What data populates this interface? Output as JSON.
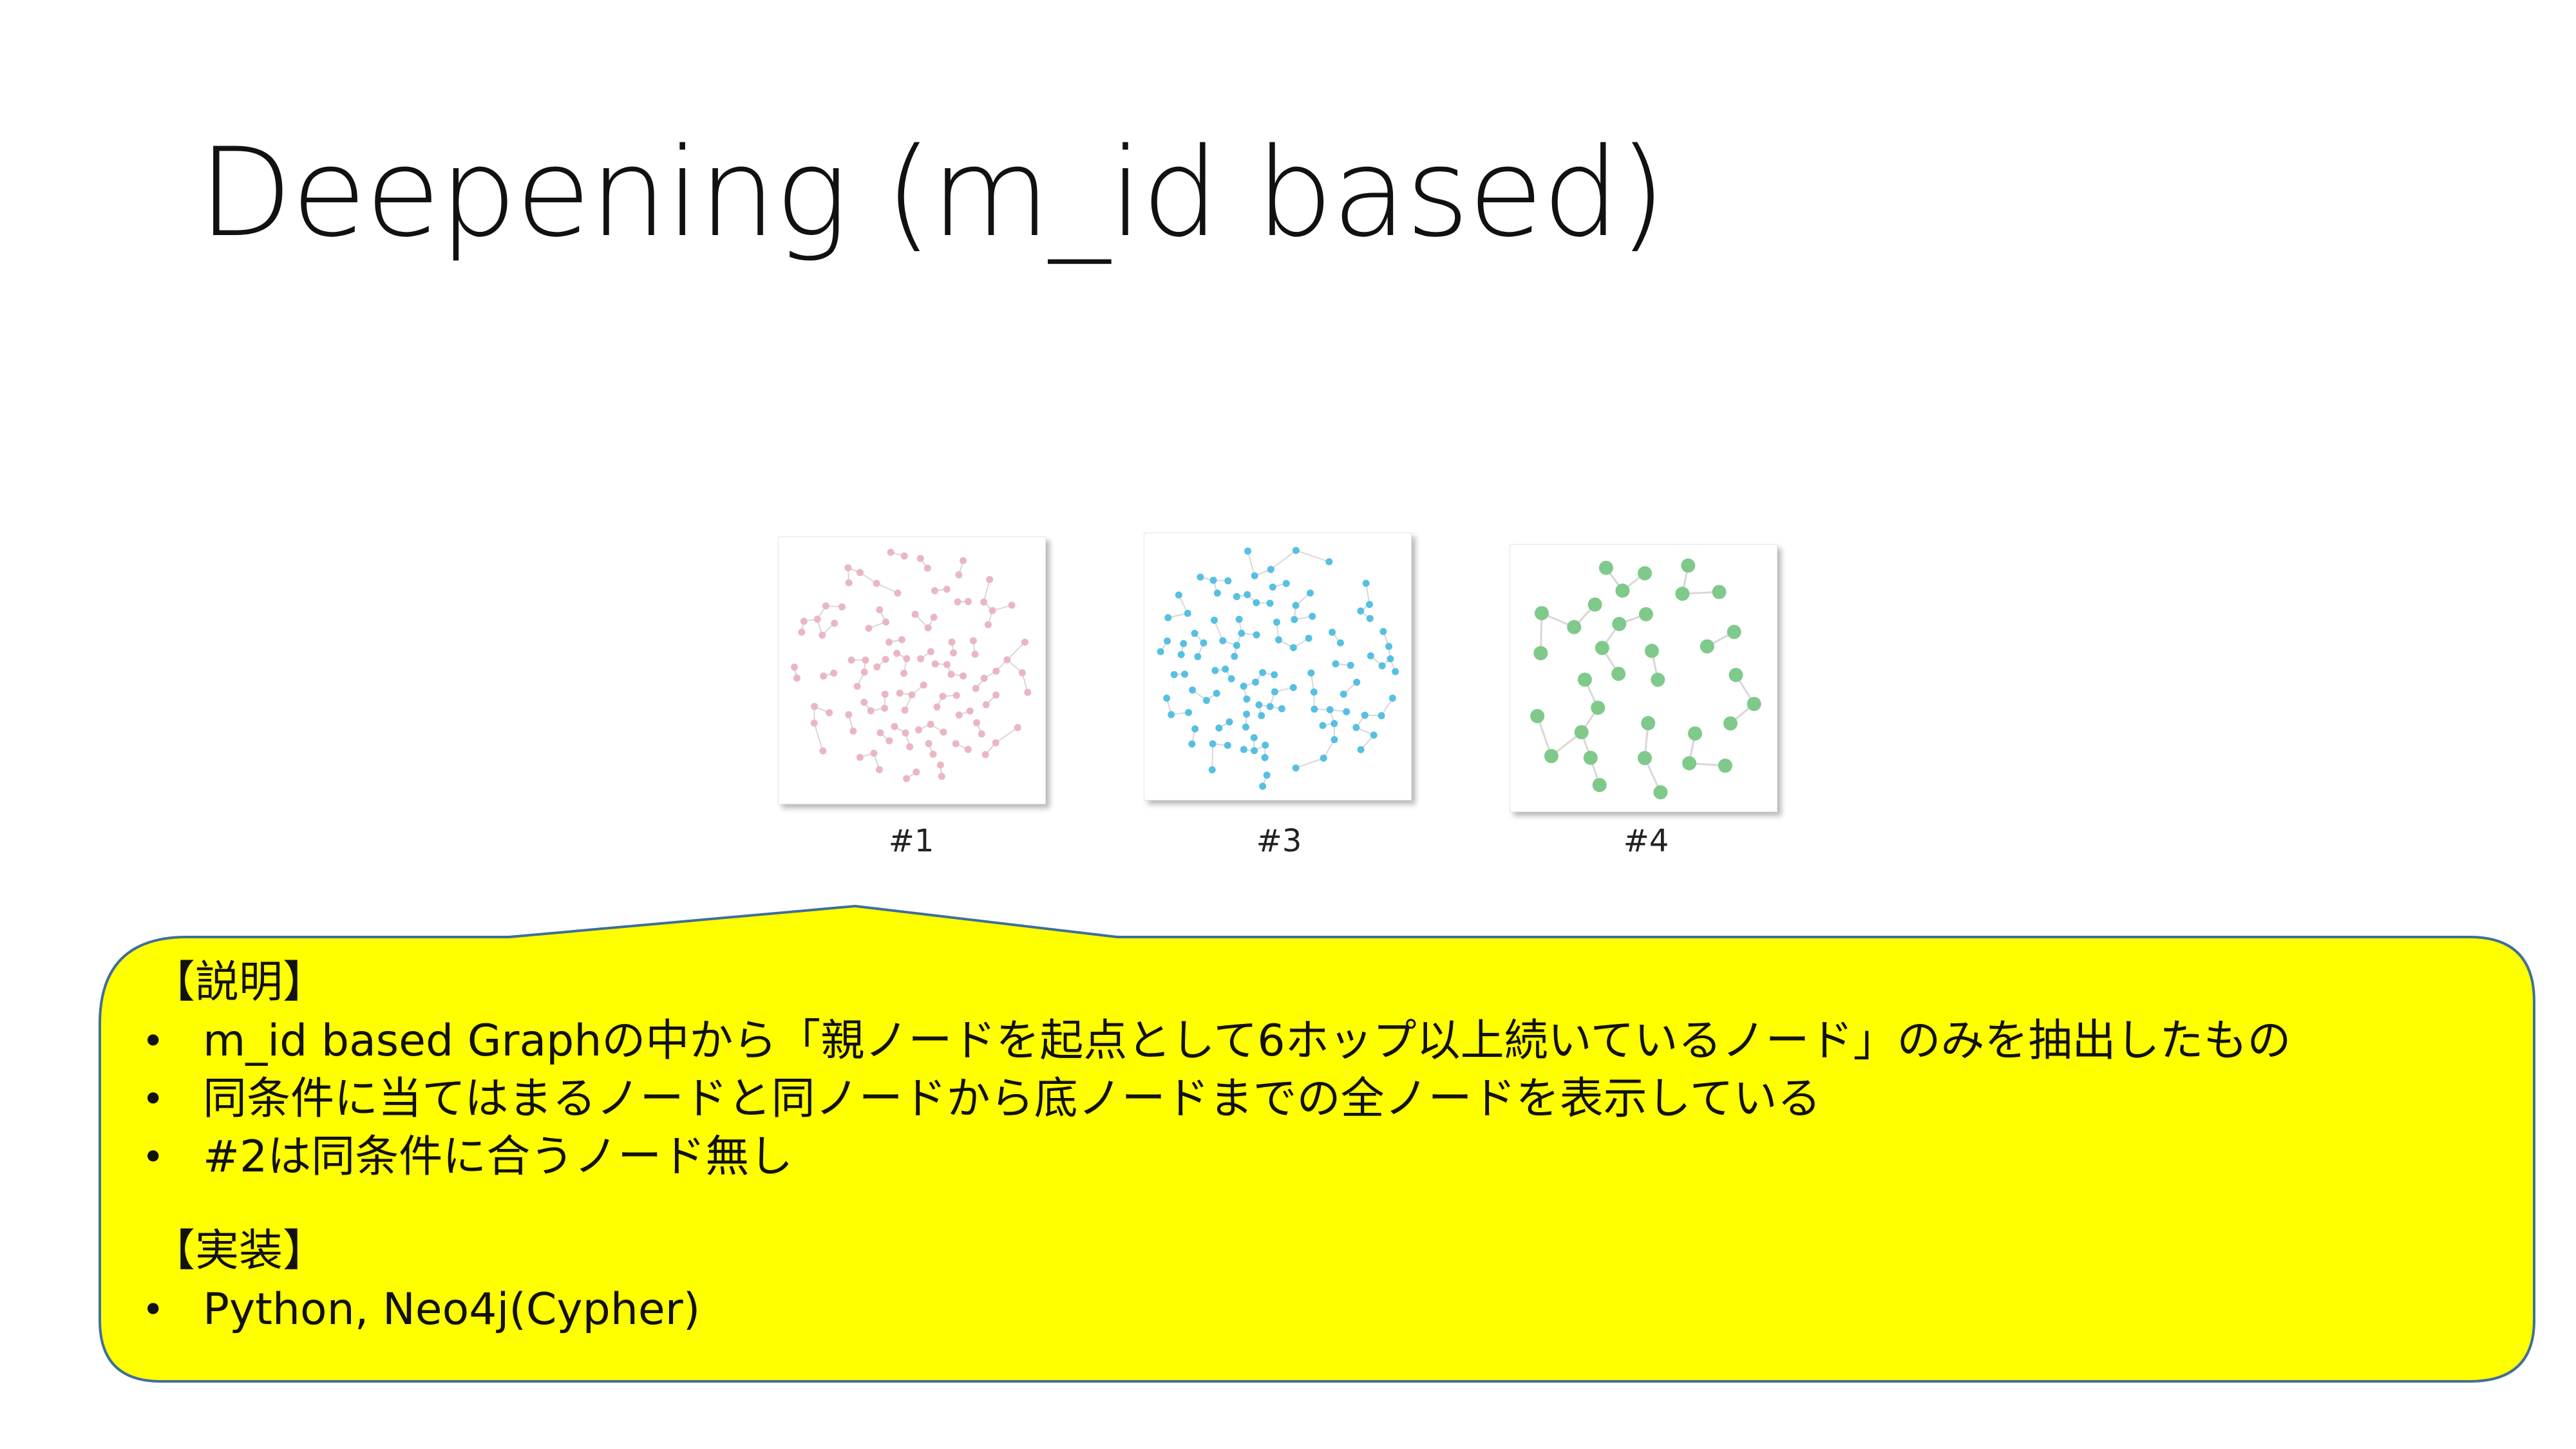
{
  "title": "Deepening (m_id based)",
  "thumbnails": [
    {
      "label": "#1",
      "color": "#eab6c2",
      "style": "small"
    },
    {
      "label": "#3",
      "color": "#55c0e2",
      "style": "small"
    },
    {
      "label": "#4",
      "color": "#7fc98a",
      "style": "large"
    }
  ],
  "callout": {
    "fill": "#ffff00",
    "border": "#3f6f9a",
    "sections": [
      {
        "heading": "【説明】",
        "items": [
          "m_id based Graphの中から「親ノードを起点として6ホップ以上続いているノード」のみを抽出したもの",
          "同条件に当てはまるノードと同ノードから底ノードまでの全ノードを表示している",
          "#2は同条件に合うノード無し"
        ]
      },
      {
        "heading": "【実装】",
        "items": [
          "Python, Neo4j(Cypher)"
        ]
      }
    ]
  }
}
